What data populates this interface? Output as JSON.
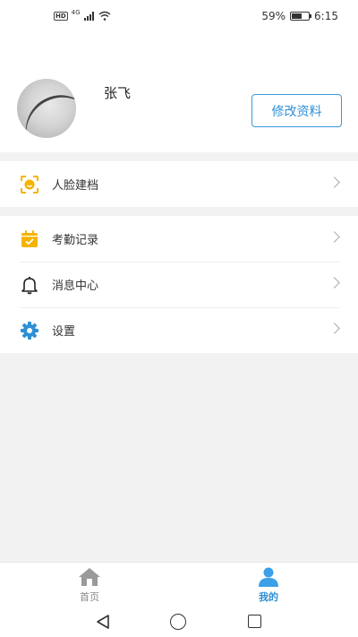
{
  "status_bar": {
    "network": "4G",
    "battery_text": "59%",
    "battery_level": 0.59,
    "time": "6:15"
  },
  "profile": {
    "name": "张飞",
    "edit_button_label": "修改资料"
  },
  "menu_group_1": [
    {
      "label": "人脸建档",
      "icon": "face-scan-icon"
    }
  ],
  "menu_group_2": [
    {
      "label": "考勤记录",
      "icon": "calendar-check-icon"
    },
    {
      "label": "消息中心",
      "icon": "bell-icon"
    },
    {
      "label": "设置",
      "icon": "gear-icon"
    }
  ],
  "bottom_nav": {
    "tabs": [
      {
        "label": "首页",
        "icon": "home-icon",
        "active": false
      },
      {
        "label": "我的",
        "icon": "user-icon",
        "active": true
      }
    ]
  },
  "colors": {
    "accent": "#2e8fd4",
    "icon_yellow": "#f5b400",
    "background": "#f2f2f2"
  }
}
